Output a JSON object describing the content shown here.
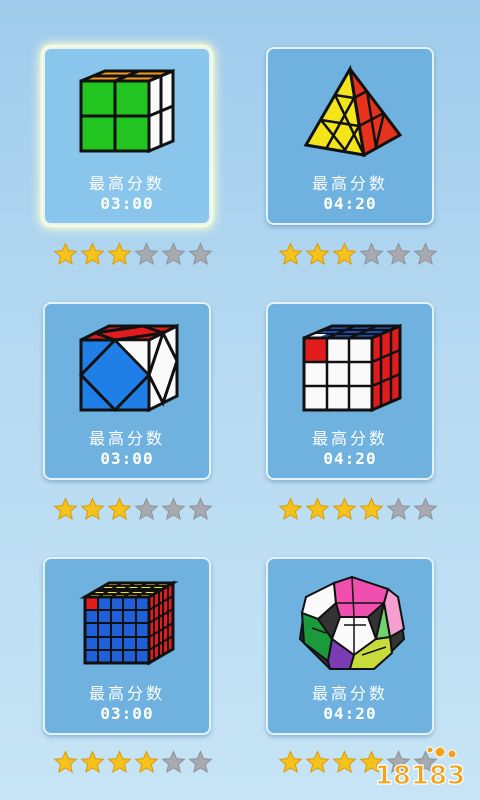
{
  "cards": [
    {
      "puzzle": "2x2-cube-icon",
      "label": "最高分数",
      "time": "03:00",
      "rating": 3,
      "max_rating": 6,
      "selected": true
    },
    {
      "puzzle": "pyraminx-icon",
      "label": "最高分数",
      "time": "04:20",
      "rating": 3,
      "max_rating": 6,
      "selected": false
    },
    {
      "puzzle": "skewb-icon",
      "label": "最高分数",
      "time": "03:00",
      "rating": 3,
      "max_rating": 6,
      "selected": false
    },
    {
      "puzzle": "3x3-cube-icon",
      "label": "最高分数",
      "time": "04:20",
      "rating": 4,
      "max_rating": 6,
      "selected": false
    },
    {
      "puzzle": "5x5-cube-icon",
      "label": "最高分数",
      "time": "03:00",
      "rating": 4,
      "max_rating": 6,
      "selected": false
    },
    {
      "puzzle": "megaminx-icon",
      "label": "最高分数",
      "time": "04:20",
      "rating": 4,
      "max_rating": 6,
      "selected": false
    }
  ],
  "colors": {
    "star_on": "#f6c21c",
    "star_off": "#a7aab0",
    "card_bg": "#6fb2e0"
  },
  "watermark": {
    "text": "18183",
    "icon": "18183-logo-watermark"
  }
}
